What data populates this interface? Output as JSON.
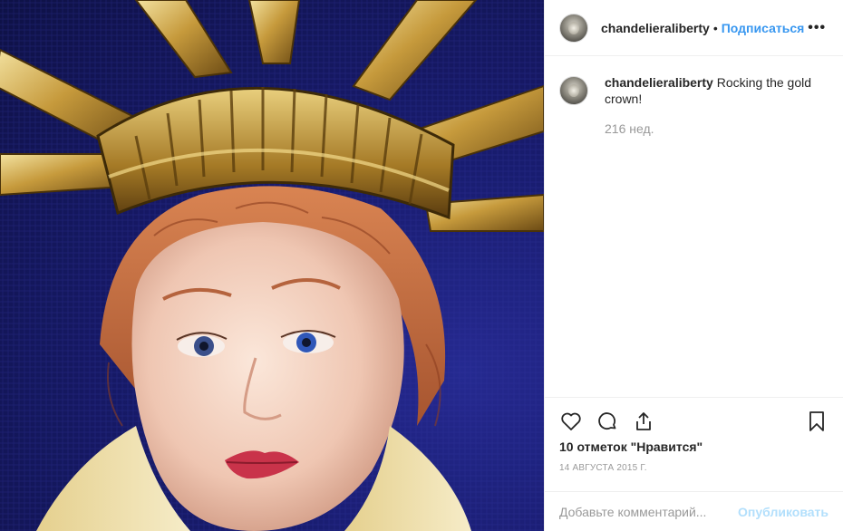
{
  "post": {
    "author": {
      "username": "chandelieraliberty",
      "follow_label": "Подписаться",
      "separator": "•"
    },
    "image": {
      "alt": "Statue of Liberty figurine with gold crown"
    },
    "caption": {
      "username": "chandelieraliberty",
      "text": "Rocking the gold crown!",
      "time_ago": "216 нед."
    },
    "likes": "10 отметок \"Нравится\"",
    "date": "14 АВГУСТА 2015 Г.",
    "comment_input": {
      "placeholder": "Добавьте комментарий...",
      "publish_label": "Опубликовать"
    },
    "icons": {
      "more": "more-options-icon",
      "like": "heart-icon",
      "comment": "comment-icon",
      "share": "share-icon",
      "save": "bookmark-icon"
    },
    "colors": {
      "follow_link": "#3897f0",
      "publish_disabled": "#b2dffc",
      "muted_text": "#999999"
    }
  }
}
